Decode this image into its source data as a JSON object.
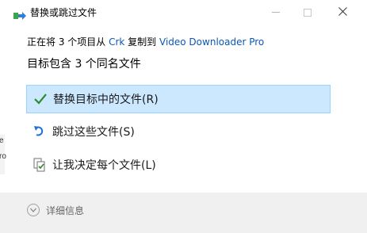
{
  "window": {
    "title": "替换或跳过文件",
    "minimize_label": "—",
    "maximize_label": "□",
    "close_label": "✕"
  },
  "dialog": {
    "subtitle_prefix": "正在将 3 个项目从 ",
    "source": "Crk",
    "subtitle_middle": " 复制到 ",
    "destination": "Video Downloader Pro",
    "heading": "目标包含 3 个同名文件"
  },
  "options": [
    {
      "label": "替换目标中的文件(R)",
      "icon": "checkmark-icon",
      "selected": true
    },
    {
      "label": "跳过这些文件(S)",
      "icon": "skip-arrow-icon",
      "selected": false
    },
    {
      "label": "让我决定每个文件(L)",
      "icon": "decide-files-icon",
      "selected": false
    }
  ],
  "footer": {
    "details_label": "详细信息"
  },
  "colors": {
    "accent_link": "#0a57b8",
    "selected_bg": "#cce8ff",
    "selected_border": "#99d1ff",
    "check_green": "#2e8b2e",
    "skip_blue": "#1e6fd9",
    "footer_bg": "#f0f0f0"
  }
}
